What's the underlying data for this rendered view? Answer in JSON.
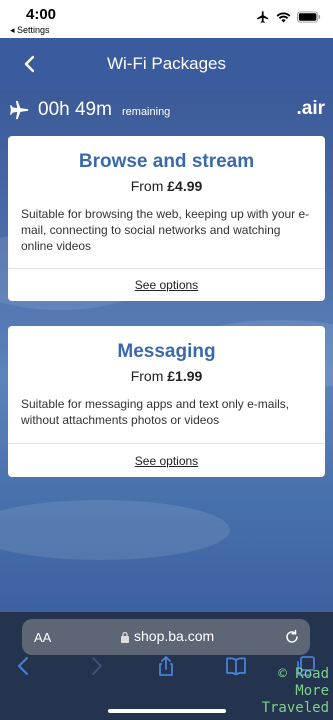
{
  "status_bar": {
    "time": "4:00",
    "back_app": "◂ Settings"
  },
  "nav": {
    "title": "Wi-Fi Packages"
  },
  "flight": {
    "time_remaining": "00h 49m",
    "remaining_label": "remaining",
    "brand": ".air"
  },
  "packages": [
    {
      "title": "Browse and stream",
      "price_prefix": "From ",
      "price": "£4.99",
      "description": "Suitable for browsing the web, keeping up with your e-mail, connecting to social networks and watching online videos",
      "link": "See options"
    },
    {
      "title": "Messaging",
      "price_prefix": "From ",
      "price": "£1.99",
      "description": "Suitable for messaging apps and text only e-mails, without attachments photos or videos",
      "link": "See options"
    }
  ],
  "browser": {
    "aa_label": "AA",
    "url": "shop.ba.com"
  },
  "watermark": [
    "© Road",
    "More",
    "Traveled"
  ],
  "colors": {
    "nav_bg": "#3a5c9e",
    "card_title": "#3a6aad",
    "safari_bg": "#24344f",
    "watermark": "#7fd08a"
  }
}
